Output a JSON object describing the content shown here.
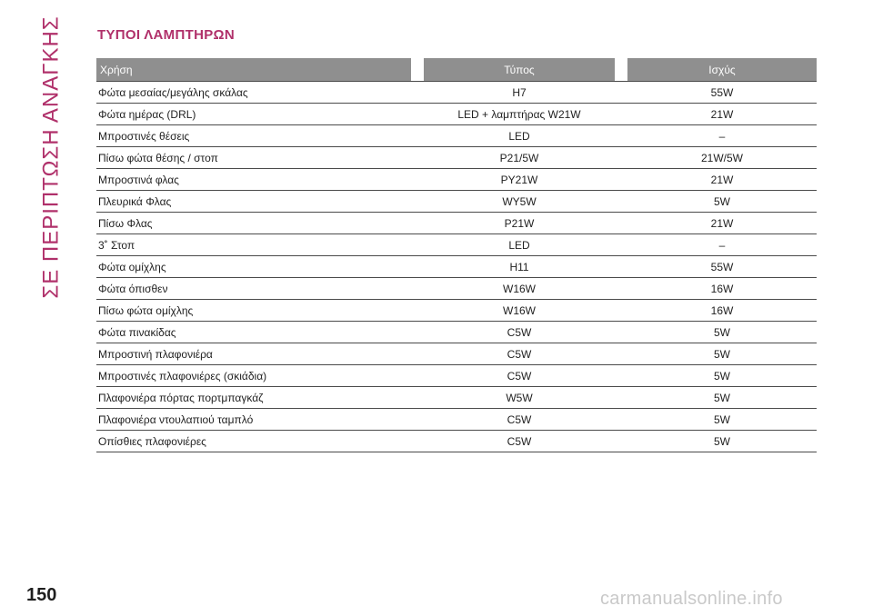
{
  "side_title": "ΣΕ ΠΕΡΙΠΤΩΣΗ ΑΝΑΓΚΗΣ",
  "section_title": "ΤΥΠΟΙ ΛΑΜΠΤΗΡΩΝ",
  "table": {
    "headers": {
      "use": "Χρήση",
      "type": "Τύπος",
      "power": "Ισχύς"
    },
    "rows": [
      {
        "use": "Φώτα μεσαίας/μεγάλης σκάλας",
        "type": "H7",
        "power": "55W"
      },
      {
        "use": "Φώτα ημέρας (DRL)",
        "type": "LED + λαμπτήρας W21W",
        "power": "21W"
      },
      {
        "use": "Μπροστινές θέσεις",
        "type": "LED",
        "power": "–"
      },
      {
        "use": "Πίσω φώτα θέσης / στοπ",
        "type": "P21/5W",
        "power": "21W/5W"
      },
      {
        "use": "Μπροστινά φλας",
        "type": "PY21W",
        "power": "21W"
      },
      {
        "use": "Πλευρικά Φλας",
        "type": "WY5W",
        "power": "5W"
      },
      {
        "use": "Πίσω Φλας",
        "type": "P21W",
        "power": "21W"
      },
      {
        "use": "3˚ Στοπ",
        "type": "LED",
        "power": "–"
      },
      {
        "use": "Φώτα ομίχλης",
        "type": "H11",
        "power": "55W"
      },
      {
        "use": "Φώτα όπισθεν",
        "type": "W16W",
        "power": "16W"
      },
      {
        "use": "Πίσω φώτα ομίχλης",
        "type": "W16W",
        "power": "16W"
      },
      {
        "use": "Φώτα πινακίδας",
        "type": "C5W",
        "power": "5W"
      },
      {
        "use": "Μπροστινή πλαφονιέρα",
        "type": "C5W",
        "power": "5W"
      },
      {
        "use": "Μπροστινές πλαφονιέρες (σκιάδια)",
        "type": "C5W",
        "power": "5W"
      },
      {
        "use": "Πλαφονιέρα πόρτας πορτμπαγκάζ",
        "type": "W5W",
        "power": "5W"
      },
      {
        "use": "Πλαφονιέρα ντουλαπιού ταμπλό",
        "type": "C5W",
        "power": "5W"
      },
      {
        "use": "Οπίσθιες πλαφονιέρες",
        "type": "C5W",
        "power": "5W"
      }
    ]
  },
  "page_number": "150",
  "watermark": "carmanualsonline.info",
  "colors": {
    "accent": "#b0306a",
    "header_bg": "#8f8f8f"
  }
}
